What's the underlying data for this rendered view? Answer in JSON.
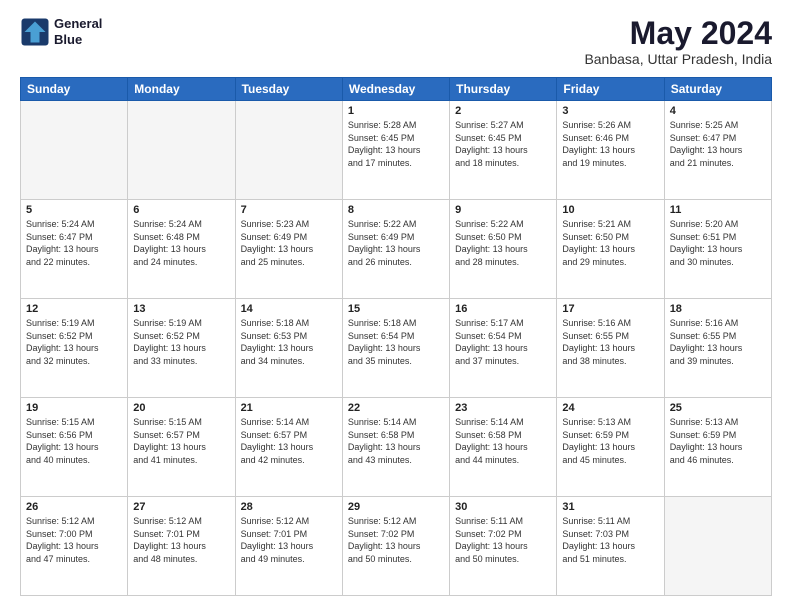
{
  "header": {
    "logo_line1": "General",
    "logo_line2": "Blue",
    "month": "May 2024",
    "location": "Banbasa, Uttar Pradesh, India"
  },
  "days_of_week": [
    "Sunday",
    "Monday",
    "Tuesday",
    "Wednesday",
    "Thursday",
    "Friday",
    "Saturday"
  ],
  "weeks": [
    [
      {
        "day": "",
        "info": ""
      },
      {
        "day": "",
        "info": ""
      },
      {
        "day": "",
        "info": ""
      },
      {
        "day": "1",
        "info": "Sunrise: 5:28 AM\nSunset: 6:45 PM\nDaylight: 13 hours\nand 17 minutes."
      },
      {
        "day": "2",
        "info": "Sunrise: 5:27 AM\nSunset: 6:45 PM\nDaylight: 13 hours\nand 18 minutes."
      },
      {
        "day": "3",
        "info": "Sunrise: 5:26 AM\nSunset: 6:46 PM\nDaylight: 13 hours\nand 19 minutes."
      },
      {
        "day": "4",
        "info": "Sunrise: 5:25 AM\nSunset: 6:47 PM\nDaylight: 13 hours\nand 21 minutes."
      }
    ],
    [
      {
        "day": "5",
        "info": "Sunrise: 5:24 AM\nSunset: 6:47 PM\nDaylight: 13 hours\nand 22 minutes."
      },
      {
        "day": "6",
        "info": "Sunrise: 5:24 AM\nSunset: 6:48 PM\nDaylight: 13 hours\nand 24 minutes."
      },
      {
        "day": "7",
        "info": "Sunrise: 5:23 AM\nSunset: 6:49 PM\nDaylight: 13 hours\nand 25 minutes."
      },
      {
        "day": "8",
        "info": "Sunrise: 5:22 AM\nSunset: 6:49 PM\nDaylight: 13 hours\nand 26 minutes."
      },
      {
        "day": "9",
        "info": "Sunrise: 5:22 AM\nSunset: 6:50 PM\nDaylight: 13 hours\nand 28 minutes."
      },
      {
        "day": "10",
        "info": "Sunrise: 5:21 AM\nSunset: 6:50 PM\nDaylight: 13 hours\nand 29 minutes."
      },
      {
        "day": "11",
        "info": "Sunrise: 5:20 AM\nSunset: 6:51 PM\nDaylight: 13 hours\nand 30 minutes."
      }
    ],
    [
      {
        "day": "12",
        "info": "Sunrise: 5:19 AM\nSunset: 6:52 PM\nDaylight: 13 hours\nand 32 minutes."
      },
      {
        "day": "13",
        "info": "Sunrise: 5:19 AM\nSunset: 6:52 PM\nDaylight: 13 hours\nand 33 minutes."
      },
      {
        "day": "14",
        "info": "Sunrise: 5:18 AM\nSunset: 6:53 PM\nDaylight: 13 hours\nand 34 minutes."
      },
      {
        "day": "15",
        "info": "Sunrise: 5:18 AM\nSunset: 6:54 PM\nDaylight: 13 hours\nand 35 minutes."
      },
      {
        "day": "16",
        "info": "Sunrise: 5:17 AM\nSunset: 6:54 PM\nDaylight: 13 hours\nand 37 minutes."
      },
      {
        "day": "17",
        "info": "Sunrise: 5:16 AM\nSunset: 6:55 PM\nDaylight: 13 hours\nand 38 minutes."
      },
      {
        "day": "18",
        "info": "Sunrise: 5:16 AM\nSunset: 6:55 PM\nDaylight: 13 hours\nand 39 minutes."
      }
    ],
    [
      {
        "day": "19",
        "info": "Sunrise: 5:15 AM\nSunset: 6:56 PM\nDaylight: 13 hours\nand 40 minutes."
      },
      {
        "day": "20",
        "info": "Sunrise: 5:15 AM\nSunset: 6:57 PM\nDaylight: 13 hours\nand 41 minutes."
      },
      {
        "day": "21",
        "info": "Sunrise: 5:14 AM\nSunset: 6:57 PM\nDaylight: 13 hours\nand 42 minutes."
      },
      {
        "day": "22",
        "info": "Sunrise: 5:14 AM\nSunset: 6:58 PM\nDaylight: 13 hours\nand 43 minutes."
      },
      {
        "day": "23",
        "info": "Sunrise: 5:14 AM\nSunset: 6:58 PM\nDaylight: 13 hours\nand 44 minutes."
      },
      {
        "day": "24",
        "info": "Sunrise: 5:13 AM\nSunset: 6:59 PM\nDaylight: 13 hours\nand 45 minutes."
      },
      {
        "day": "25",
        "info": "Sunrise: 5:13 AM\nSunset: 6:59 PM\nDaylight: 13 hours\nand 46 minutes."
      }
    ],
    [
      {
        "day": "26",
        "info": "Sunrise: 5:12 AM\nSunset: 7:00 PM\nDaylight: 13 hours\nand 47 minutes."
      },
      {
        "day": "27",
        "info": "Sunrise: 5:12 AM\nSunset: 7:01 PM\nDaylight: 13 hours\nand 48 minutes."
      },
      {
        "day": "28",
        "info": "Sunrise: 5:12 AM\nSunset: 7:01 PM\nDaylight: 13 hours\nand 49 minutes."
      },
      {
        "day": "29",
        "info": "Sunrise: 5:12 AM\nSunset: 7:02 PM\nDaylight: 13 hours\nand 50 minutes."
      },
      {
        "day": "30",
        "info": "Sunrise: 5:11 AM\nSunset: 7:02 PM\nDaylight: 13 hours\nand 50 minutes."
      },
      {
        "day": "31",
        "info": "Sunrise: 5:11 AM\nSunset: 7:03 PM\nDaylight: 13 hours\nand 51 minutes."
      },
      {
        "day": "",
        "info": ""
      }
    ]
  ]
}
